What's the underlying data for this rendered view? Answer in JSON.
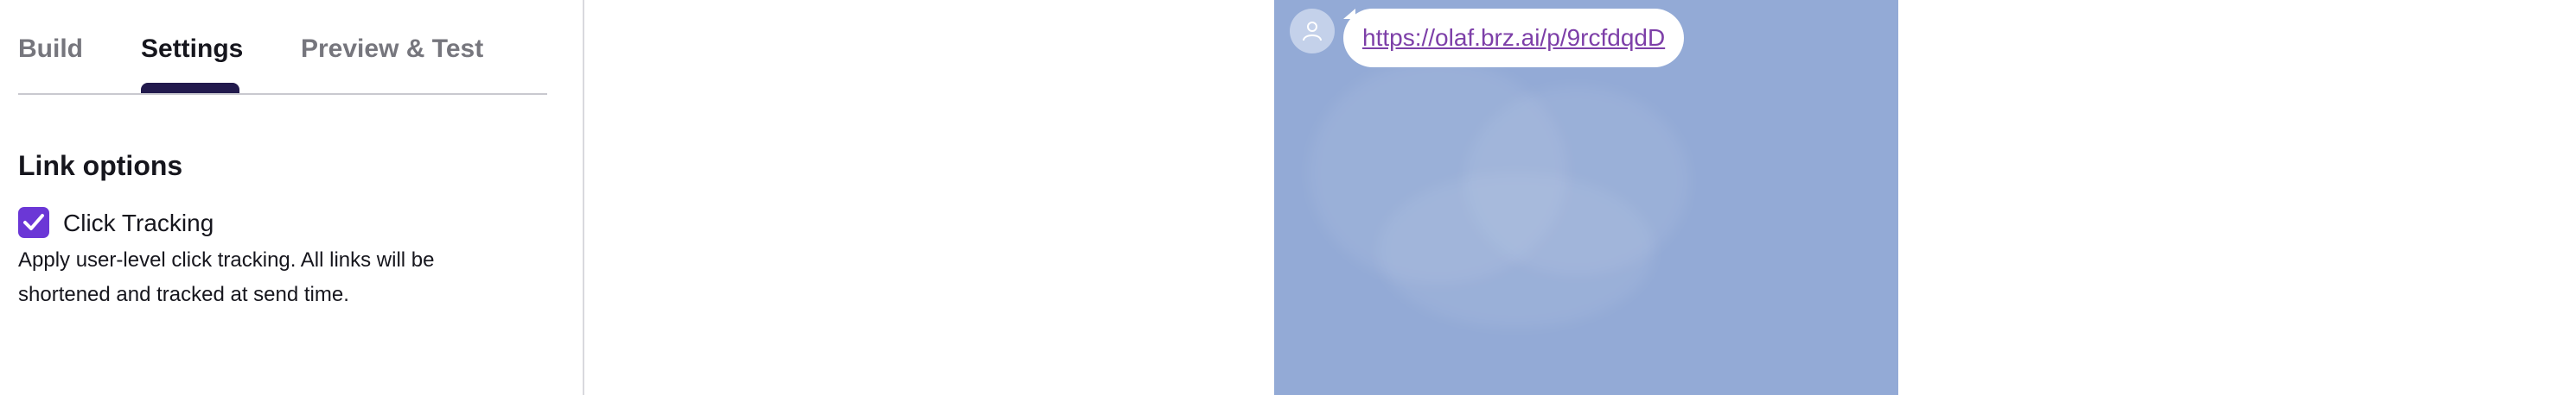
{
  "tabs": {
    "build": "Build",
    "settings": "Settings",
    "preview": "Preview & Test",
    "active": "settings"
  },
  "link_options": {
    "title": "Link options",
    "click_tracking": {
      "label": "Click Tracking",
      "checked": true,
      "description": "Apply user-level click tracking. All links will be shortened and tracked at send time."
    }
  },
  "preview": {
    "background_color": "#93aad6",
    "message_link": "https://olaf.brz.ai/p/9rcfdqdD",
    "avatar_icon": "user-icon"
  },
  "colors": {
    "accent": "#6b37d6",
    "tab_indicator": "#221a4d",
    "link": "#7d3fa8"
  }
}
